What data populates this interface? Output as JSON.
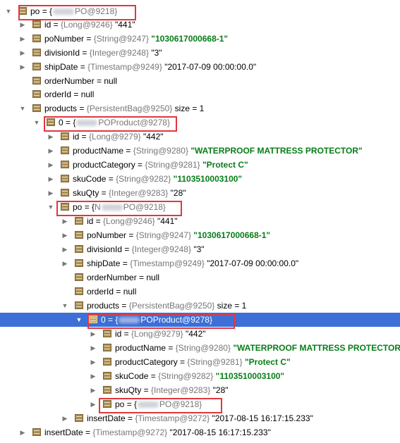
{
  "tree": {
    "nodes": [
      {
        "expander": "▼",
        "expandable": true,
        "name": "po",
        "eq": " = {",
        "type_pre": "",
        "type_post": "PO@9218}",
        "blurred": true
      },
      {
        "expander": "▶",
        "expandable": true,
        "name": "id",
        "eq": " = ",
        "type": "{Long@9246}",
        "value": " \"441\"",
        "value_kind": "plain"
      },
      {
        "expander": "▶",
        "expandable": true,
        "name": "poNumber",
        "eq": " = ",
        "type": "{String@9247}",
        "value": " \"1030617000668-1\"",
        "value_kind": "string"
      },
      {
        "expander": "▶",
        "expandable": true,
        "name": "divisionId",
        "eq": " = ",
        "type": "{Integer@9248}",
        "value": " \"3\"",
        "value_kind": "plain"
      },
      {
        "expander": "▶",
        "expandable": true,
        "name": "shipDate",
        "eq": " = ",
        "type": "{Timestamp@9249}",
        "value": " \"2017-07-09 00:00:00.0\"",
        "value_kind": "plain"
      },
      {
        "expander": "",
        "expandable": false,
        "name": "orderNumber",
        "eq": " = null",
        "type": "",
        "value": "",
        "value_kind": "plain"
      },
      {
        "expander": "",
        "expandable": false,
        "name": "orderId",
        "eq": " = null",
        "type": "",
        "value": "",
        "value_kind": "plain"
      },
      {
        "expander": "▼",
        "expandable": true,
        "name": "products",
        "eq": " = ",
        "type": "{PersistentBag@9250}",
        "value": "  size = 1",
        "value_kind": "plain"
      },
      {
        "expander": "▼",
        "expandable": true,
        "name": "0",
        "eq": " = {",
        "type_pre": "",
        "type_post": "POProduct@9278}",
        "blurred": true
      },
      {
        "expander": "▶",
        "expandable": true,
        "name": "id",
        "eq": " = ",
        "type": "{Long@9279}",
        "value": " \"442\"",
        "value_kind": "plain"
      },
      {
        "expander": "▶",
        "expandable": true,
        "name": "productName",
        "eq": " = ",
        "type": "{String@9280}",
        "value": " \"WATERPROOF MATTRESS PROTECTOR\"",
        "value_kind": "string"
      },
      {
        "expander": "▶",
        "expandable": true,
        "name": "productCategory",
        "eq": " = ",
        "type": "{String@9281}",
        "value": " \"Protect C\"",
        "value_kind": "string"
      },
      {
        "expander": "▶",
        "expandable": true,
        "name": "skuCode",
        "eq": " = ",
        "type": "{String@9282}",
        "value": " \"1103510003100\"",
        "value_kind": "string"
      },
      {
        "expander": "▶",
        "expandable": true,
        "name": "skuQty",
        "eq": " = ",
        "type": "{Integer@9283}",
        "value": " \"28\"",
        "value_kind": "plain"
      },
      {
        "expander": "▼",
        "expandable": true,
        "name": "po",
        "eq": " = {",
        "type_pre": "N",
        "type_post": "PO@9218}",
        "blurred": true
      },
      {
        "expander": "▶",
        "expandable": true,
        "name": "id",
        "eq": " = ",
        "type": "{Long@9246}",
        "value": " \"441\"",
        "value_kind": "plain"
      },
      {
        "expander": "▶",
        "expandable": true,
        "name": "poNumber",
        "eq": " = ",
        "type": "{String@9247}",
        "value": " \"1030617000668-1\"",
        "value_kind": "string"
      },
      {
        "expander": "▶",
        "expandable": true,
        "name": "divisionId",
        "eq": " = ",
        "type": "{Integer@9248}",
        "value": " \"3\"",
        "value_kind": "plain"
      },
      {
        "expander": "▶",
        "expandable": true,
        "name": "shipDate",
        "eq": " = ",
        "type": "{Timestamp@9249}",
        "value": " \"2017-07-09 00:00:00.0\"",
        "value_kind": "plain"
      },
      {
        "expander": "",
        "expandable": false,
        "name": "orderNumber",
        "eq": " = null",
        "type": "",
        "value": "",
        "value_kind": "plain"
      },
      {
        "expander": "",
        "expandable": false,
        "name": "orderId",
        "eq": " = null",
        "type": "",
        "value": "",
        "value_kind": "plain"
      },
      {
        "expander": "▼",
        "expandable": true,
        "name": "products",
        "eq": " = ",
        "type": "{PersistentBag@9250}",
        "value": "  size = 1",
        "value_kind": "plain"
      },
      {
        "expander": "▼",
        "expandable": true,
        "name": "0",
        "eq": " = {",
        "type_pre": "",
        "type_post": "POProduct@9278}",
        "blurred": true,
        "selected": true
      },
      {
        "expander": "▶",
        "expandable": true,
        "name": "id",
        "eq": " = ",
        "type": "{Long@9279}",
        "value": " \"442\"",
        "value_kind": "plain"
      },
      {
        "expander": "▶",
        "expandable": true,
        "name": "productName",
        "eq": " = ",
        "type": "{String@9280}",
        "value": " \"WATERPROOF MATTRESS PROTECTOR\"",
        "value_kind": "string"
      },
      {
        "expander": "▶",
        "expandable": true,
        "name": "productCategory",
        "eq": " = ",
        "type": "{String@9281}",
        "value": " \"Protect C\"",
        "value_kind": "string"
      },
      {
        "expander": "▶",
        "expandable": true,
        "name": "skuCode",
        "eq": " = ",
        "type": "{String@9282}",
        "value": " \"1103510003100\"",
        "value_kind": "string"
      },
      {
        "expander": "▶",
        "expandable": true,
        "name": "skuQty",
        "eq": " = ",
        "type": "{Integer@9283}",
        "value": " \"28\"",
        "value_kind": "plain"
      },
      {
        "expander": "▶",
        "expandable": true,
        "name": "po",
        "eq": " = {",
        "type_pre": "",
        "type_post": "PO@9218}",
        "blurred": true
      },
      {
        "expander": "▶",
        "expandable": true,
        "name": "insertDate",
        "eq": " = ",
        "type": "{Timestamp@9272}",
        "value": " \"2017-08-15 16:17:15.233\"",
        "value_kind": "plain"
      },
      {
        "expander": "▶",
        "expandable": true,
        "name": "insertDate",
        "eq": " = ",
        "type": "{Timestamp@9272}",
        "value": " \"2017-08-15 16:17:15.233\"",
        "value_kind": "plain"
      }
    ]
  },
  "colors": {
    "selection": "#3d6fd6",
    "highlight_border": "#e0383d",
    "string_value": "#067d17",
    "type_label": "#777777",
    "field_icon": "#a88c55"
  },
  "icons": {
    "field": "field-icon",
    "expand": "chevron-right-icon",
    "collapse": "chevron-down-icon"
  }
}
